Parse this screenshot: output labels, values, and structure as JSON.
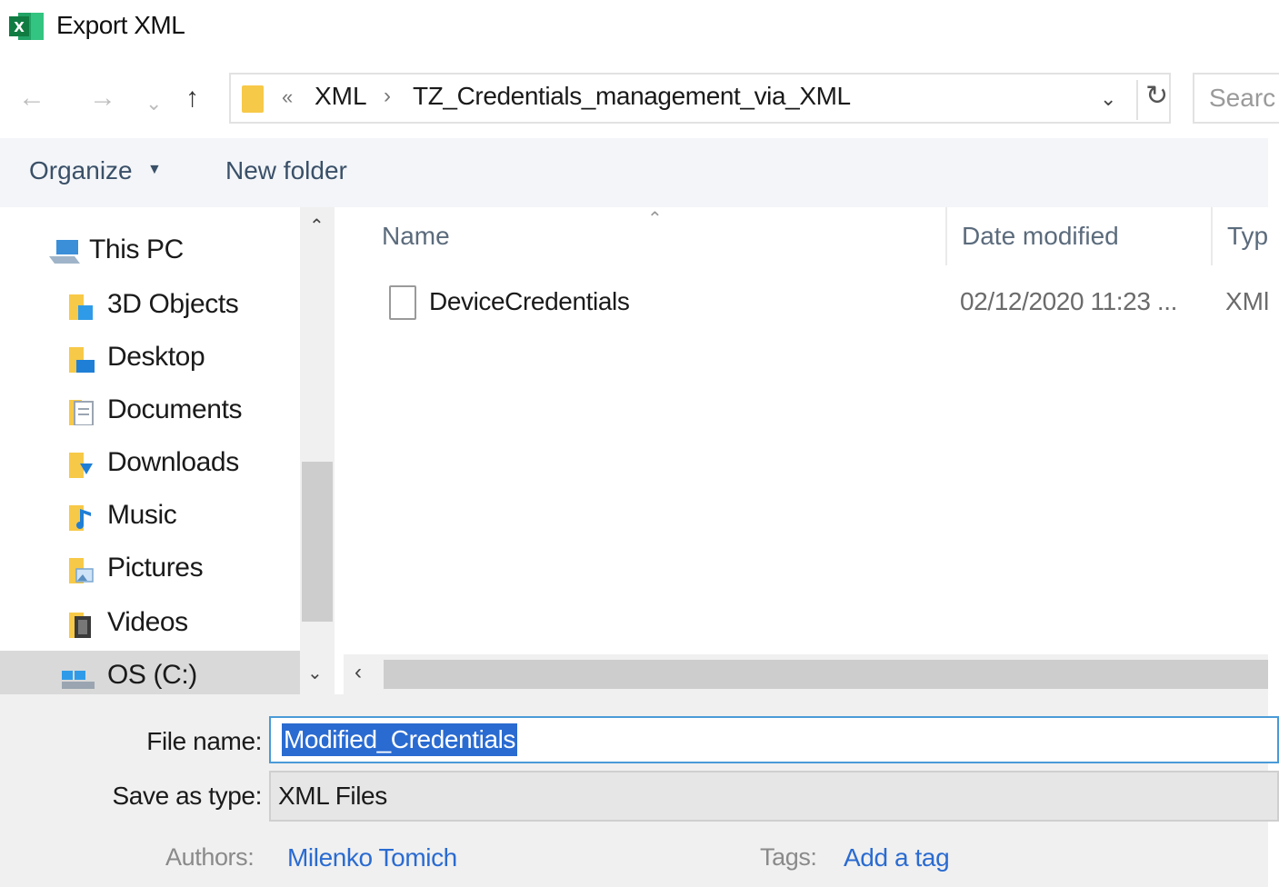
{
  "window": {
    "title": "Export XML",
    "app_icon": "excel-icon"
  },
  "nav": {
    "back_icon": "arrow-left-icon",
    "forward_icon": "arrow-right-icon",
    "recent_icon": "chevron-down-icon",
    "up_icon": "arrow-up-icon",
    "address": {
      "overflow": "«",
      "segments": [
        "XML",
        "TZ_Credentials_management_via_XML"
      ],
      "separator": "›"
    },
    "search_placeholder": "Searc"
  },
  "toolbar": {
    "organize_label": "Organize",
    "new_folder_label": "New folder"
  },
  "sidebar": {
    "items": [
      {
        "label": "This PC",
        "icon": "computer-icon",
        "selected": false
      },
      {
        "label": "3D Objects",
        "icon": "3d-objects-folder-icon",
        "selected": false
      },
      {
        "label": "Desktop",
        "icon": "desktop-folder-icon",
        "selected": false
      },
      {
        "label": "Documents",
        "icon": "documents-folder-icon",
        "selected": false
      },
      {
        "label": "Downloads",
        "icon": "downloads-folder-icon",
        "selected": false
      },
      {
        "label": "Music",
        "icon": "music-folder-icon",
        "selected": false
      },
      {
        "label": "Pictures",
        "icon": "pictures-folder-icon",
        "selected": false
      },
      {
        "label": "Videos",
        "icon": "videos-folder-icon",
        "selected": false
      },
      {
        "label": "OS (C:)",
        "icon": "drive-icon",
        "selected": true
      }
    ]
  },
  "filelist": {
    "columns": {
      "name": "Name",
      "date": "Date modified",
      "type": "Typ"
    },
    "rows": [
      {
        "name": "DeviceCredentials",
        "date": "02/12/2020 11:23 ...",
        "type": "XMl"
      }
    ]
  },
  "form": {
    "filename_label": "File name:",
    "filename_value": "Modified_Credentials",
    "saveas_label": "Save as type:",
    "saveas_value": "XML Files",
    "authors_label": "Authors:",
    "authors_value": "Milenko Tomich",
    "tags_label": "Tags:",
    "tags_value": "Add a tag"
  },
  "colors": {
    "accent": "#2a6bd1",
    "toolbar_text": "#3a5068",
    "folder": "#f7c948"
  }
}
